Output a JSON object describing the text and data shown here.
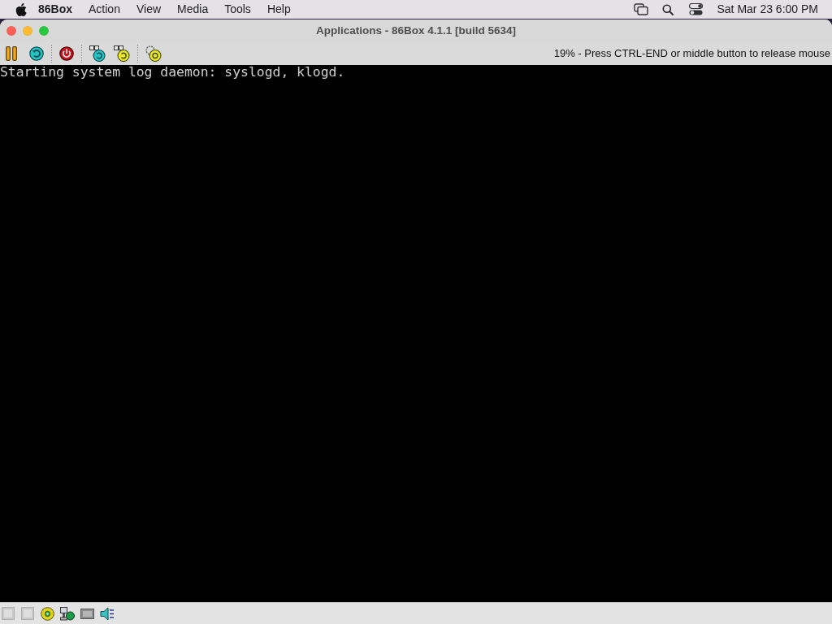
{
  "menu_bar": {
    "app_name": "86Box",
    "menus": [
      "Action",
      "View",
      "Media",
      "Tools",
      "Help"
    ],
    "clock": "Sat Mar 23 6:00 PM"
  },
  "window": {
    "title": "Applications - 86Box 4.1.1 [build 5634]"
  },
  "toolbar": {
    "status_message": "19% - Press CTRL-END or middle button to release mouse"
  },
  "screen": {
    "lines": [
      "Starting system log daemon: syslogd, klogd."
    ]
  }
}
